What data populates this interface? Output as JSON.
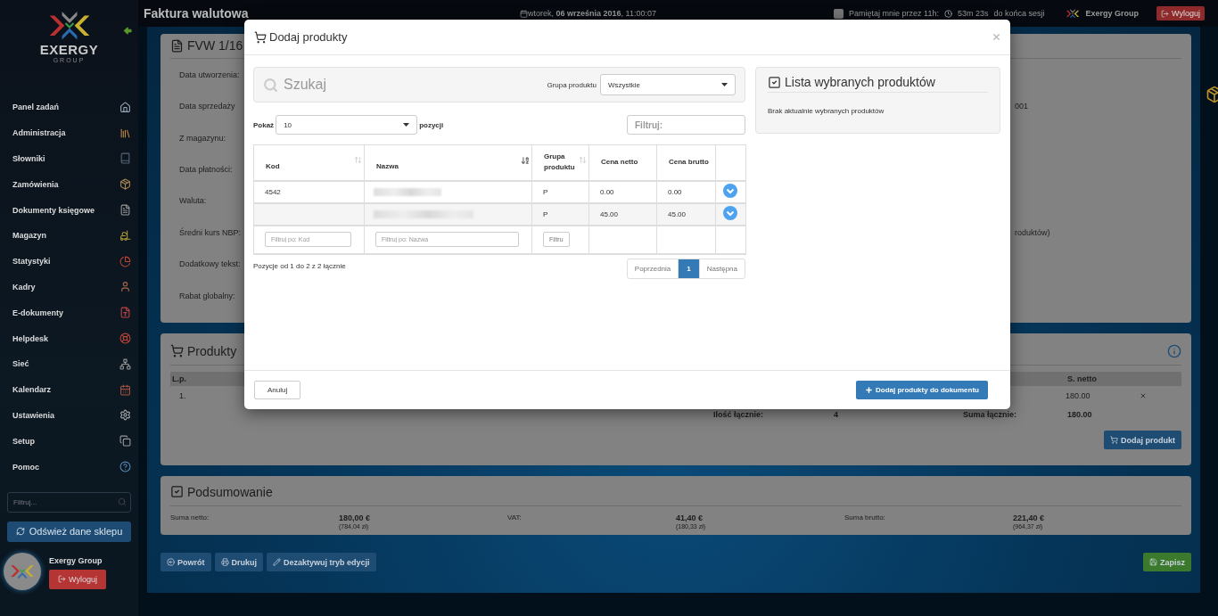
{
  "topbar": {
    "title": "Faktura walutowa",
    "date": "wtorek, **06 września 2016**, 11:00:07",
    "remember": {
      "label": "Pamiętaj mnie przez 11h:",
      "checked": false
    },
    "session_time": "53m 23s",
    "session_suffix": "do końca sesji",
    "user": "Exergy Group",
    "logout": "Wyloguj"
  },
  "sidebar": {
    "logo_text": "EXERGY",
    "logo_subtext": "GROUP",
    "items": [
      {
        "label": "Panel zadań"
      },
      {
        "label": "Administracja"
      },
      {
        "label": "Słowniki"
      },
      {
        "label": "Zamówienia"
      },
      {
        "label": "Dokumenty księgowe"
      },
      {
        "label": "Magazyn"
      },
      {
        "label": "Statystyki"
      },
      {
        "label": "Kadry"
      },
      {
        "label": "E-dokumenty"
      },
      {
        "label": "Helpdesk"
      },
      {
        "label": "Sieć"
      },
      {
        "label": "Kalendarz"
      },
      {
        "label": "Ustawienia"
      },
      {
        "label": "Setup"
      },
      {
        "label": "Pomoc"
      }
    ],
    "filter_placeholder": "Filtruj...",
    "refresh": "Odśwież dane sklepu",
    "user": {
      "name": "Exergy Group",
      "logout": "Wyloguj"
    }
  },
  "invoice": {
    "title": "FVW 1/16",
    "fields": [
      {
        "label": "Data utworzenia:"
      },
      {
        "label": "Data sprzedaży",
        "value": "001"
      },
      {
        "label": "Z magazynu:"
      },
      {
        "label": "Data płatności:"
      },
      {
        "label": "Waluta:"
      },
      {
        "label": "Średni kurs NBP:",
        "value": "roduktów)"
      },
      {
        "label": "Dodatkowy tekst:"
      },
      {
        "label": "Rabat globalny:"
      }
    ]
  },
  "products": {
    "title": "Produkty",
    "columns": [
      "L.p.",
      "S. netto"
    ],
    "rows": [
      [
        "1.",
        "180.00"
      ]
    ],
    "totals": {
      "qty_label": "Ilość łącznie:",
      "qty": "4",
      "sum_label": "Suma łącznie:",
      "sum": "180.00"
    },
    "add_button": "Dodaj produkt"
  },
  "summary": {
    "title": "Podsumowanie",
    "items": [
      {
        "label": "Suma netto:",
        "value": "180,00 €",
        "pln": "(784,04 zł)"
      },
      {
        "label": "VAT:",
        "value": "41,40 €",
        "pln": "(180,33 zł)"
      },
      {
        "label": "Suma brutto:",
        "value": "221,40 €",
        "pln": "(964,37 zł)"
      }
    ]
  },
  "actions": [
    "Powrót",
    "Drukuj",
    "Dezaktywuj tryb edycji"
  ],
  "save": "Zapisz",
  "modal": {
    "title": "Dodaj produkty",
    "search_placeholder": "Szukaj",
    "group_label": "Grupa produktu",
    "group_value": "Wszystkie",
    "show_label": "Pokaż",
    "show_value": "10",
    "show_suffix": "pozycji",
    "filter_placeholder": "Filtruj:",
    "columns": [
      {
        "label": "Kod",
        "sortable": true,
        "sorted": false
      },
      {
        "label": "Nazwa",
        "sortable": true,
        "sorted": true
      },
      {
        "label": "Grupa produktu",
        "sortable": true,
        "sorted": false
      },
      {
        "label": "Cena netto"
      },
      {
        "label": "Cena brutto"
      }
    ],
    "rows": [
      {
        "code": "4542",
        "group": "P",
        "net": "0.00",
        "gross": "0.00"
      },
      {
        "group": "P",
        "net": "45.00",
        "gross": "45.00"
      }
    ],
    "column_filters": {
      "code_placeholder": "Filtruj po: Kod",
      "name_placeholder": "Filtruj po: Nazwa",
      "group_button": "Filtru"
    },
    "info": "Pozycje od 1 do 2 z 2 łącznie",
    "pagination": {
      "previous": "Poprzednia",
      "pages": [
        {
          "label": "1",
          "selected": true
        }
      ],
      "next": "Następna"
    },
    "selected_panel": {
      "title": "Lista wybranych produktów",
      "empty": "Brak aktualnie wybranych produktów"
    },
    "cancel": "Anuluj",
    "submit": "Dodaj produkty do dokumentu"
  }
}
